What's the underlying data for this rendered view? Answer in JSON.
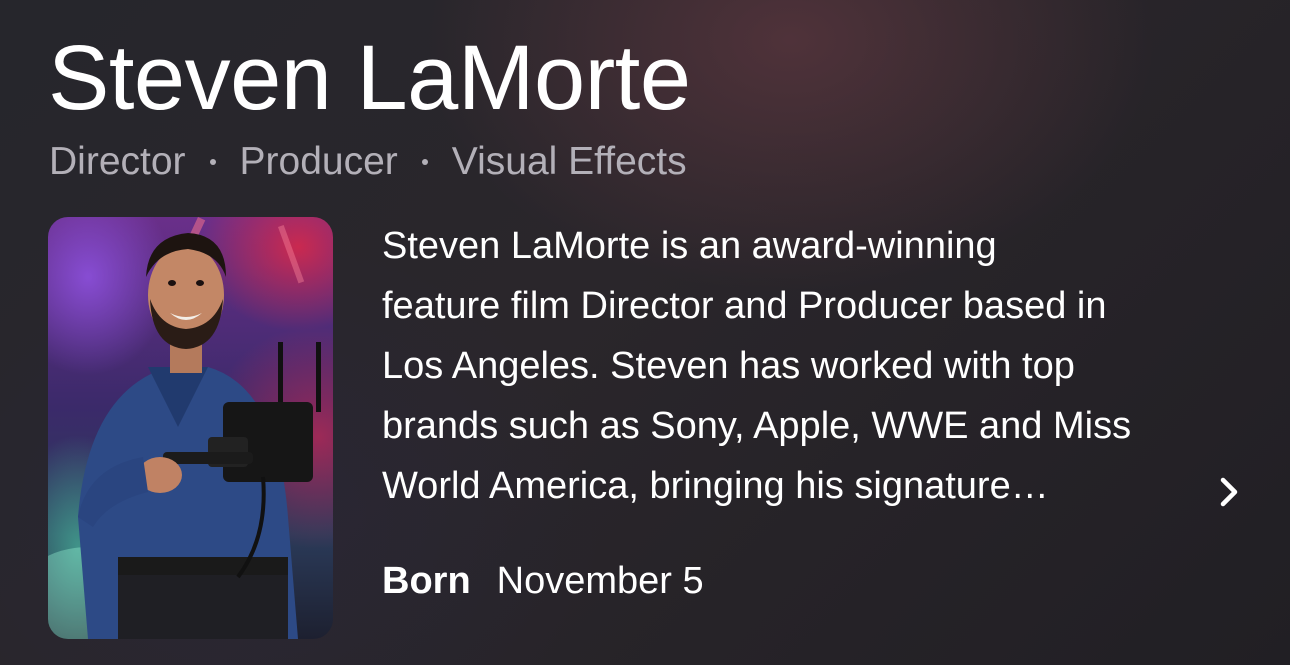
{
  "person": {
    "name": "Steven LaMorte",
    "roles": [
      "Director",
      "Producer",
      "Visual Effects"
    ],
    "photo_alt": "Steven LaMorte"
  },
  "bio": {
    "lines": [
      "Steven LaMorte is an award-winning",
      "feature film Director and Producer based in",
      "Los Angeles. Steven has worked with top",
      "brands such as Sony, Apple, WWE and Miss",
      "World America, bringing his signature…"
    ]
  },
  "facts": {
    "born_label": "Born",
    "born_value": "November 5"
  },
  "icons": {
    "expand": "chevron-right-icon"
  },
  "colors": {
    "text_primary": "#ffffff",
    "text_secondary": "#b3b0b8",
    "background": "#26262c"
  }
}
